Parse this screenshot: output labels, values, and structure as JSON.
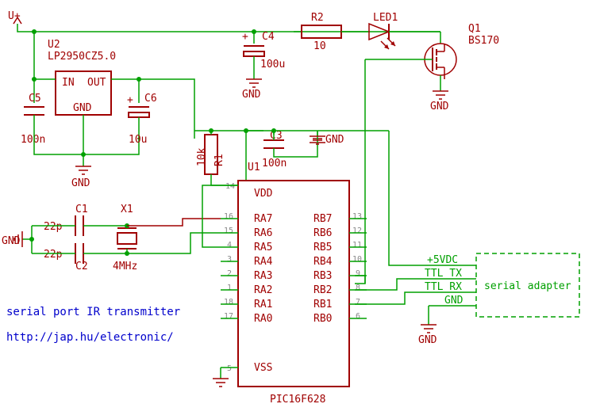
{
  "title": "serial port IR transmitter",
  "url": "http://jap.hu/electronic/",
  "power_label": "U+",
  "components": {
    "U1": {
      "ref": "U1",
      "part": "PIC16F628",
      "pins_left": [
        "RA7",
        "RA6",
        "RA5",
        "RA4",
        "RA3",
        "RA2",
        "RA1",
        "RA0"
      ],
      "pins_right": [
        "RB7",
        "RB6",
        "RB5",
        "RB4",
        "RB3",
        "RB2",
        "RB1",
        "RB0"
      ],
      "pin_nums_left": [
        "16",
        "15",
        "4",
        "3",
        "2",
        "1",
        "18",
        "17"
      ],
      "pin_nums_right": [
        "13",
        "12",
        "11",
        "10",
        "9",
        "8",
        "7",
        "6"
      ],
      "vdd": "VDD",
      "vss": "VSS",
      "vdd_pin": "14",
      "vss_pin": "5"
    },
    "U2": {
      "ref": "U2",
      "part": "LP2950CZ5.0",
      "in": "IN",
      "out": "OUT",
      "gnd": "GND"
    },
    "R1": {
      "ref": "R1",
      "value": "10k"
    },
    "R2": {
      "ref": "R2",
      "value": "10"
    },
    "C1": {
      "ref": "C1",
      "value": "22p"
    },
    "C2": {
      "ref": "C2",
      "value": "22p"
    },
    "C3": {
      "ref": "C3",
      "value": "100n"
    },
    "C4": {
      "ref": "C4",
      "value": "100u"
    },
    "C5": {
      "ref": "C5",
      "value": "100n"
    },
    "C6": {
      "ref": "C6",
      "value": "10u"
    },
    "X1": {
      "ref": "X1",
      "value": "4MHz"
    },
    "LED1": {
      "ref": "LED1"
    },
    "Q1": {
      "ref": "Q1",
      "part": "BS170"
    }
  },
  "gnd": "GND",
  "adapter": {
    "label": "serial adapter",
    "lines": [
      "+5VDC",
      "TTL TX",
      "TTL RX",
      "GND"
    ]
  }
}
